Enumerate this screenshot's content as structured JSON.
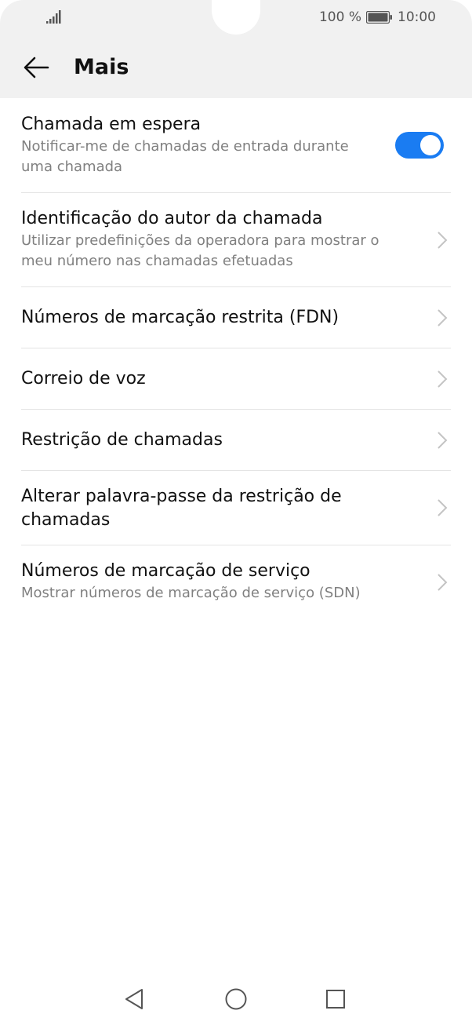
{
  "status_bar": {
    "battery_percent": "100 %",
    "time": "10:00"
  },
  "header": {
    "title": "Mais"
  },
  "settings": [
    {
      "title": "Chamada em espera",
      "subtitle": "Notificar-me de chamadas de entrada durante uma chamada",
      "control": "toggle",
      "toggle_on": true
    },
    {
      "title": "Identificação do autor da chamada",
      "subtitle": "Utilizar predefinições da operadora para mostrar o meu número nas chamadas efetuadas",
      "control": "chevron"
    },
    {
      "title": "Números de marcação restrita (FDN)",
      "control": "chevron"
    },
    {
      "title": "Correio de voz",
      "control": "chevron"
    },
    {
      "title": "Restrição de chamadas",
      "control": "chevron"
    },
    {
      "title": "Alterar palavra-passe da restrição de chamadas",
      "control": "chevron"
    },
    {
      "title": "Números de marcação de serviço",
      "subtitle": "Mostrar números de marcação de serviço (SDN)",
      "control": "chevron"
    }
  ],
  "colors": {
    "accent": "#1a7cf2",
    "header_bg": "#f1f1f1",
    "divider": "#e4e4e4",
    "secondary_text": "#808080"
  }
}
